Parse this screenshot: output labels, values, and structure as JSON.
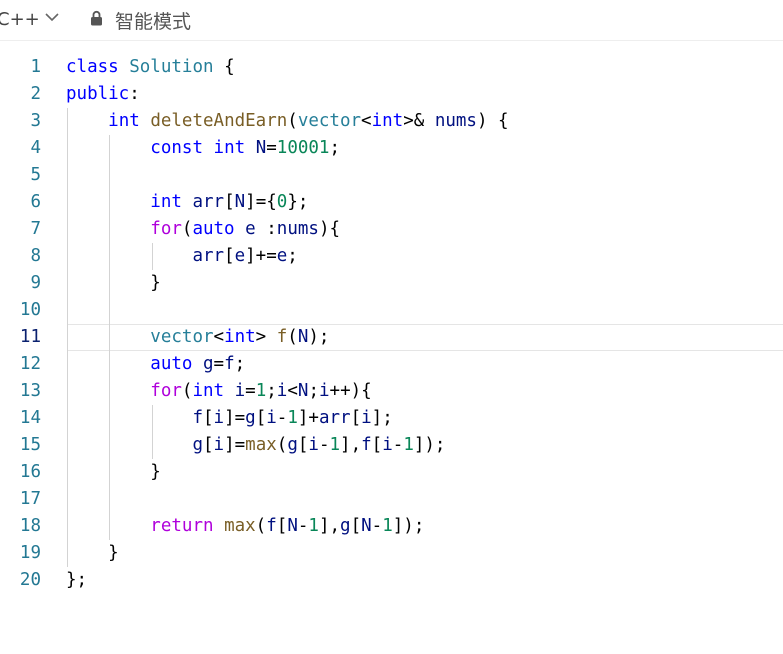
{
  "toolbar": {
    "language": "C++",
    "mode": "智能模式",
    "icons": {
      "language_dropdown": "chevron-down-icon",
      "mode": "lock-icon"
    }
  },
  "editor": {
    "active_line": 11,
    "lines": [
      {
        "n": "1",
        "tokens": [
          [
            "keyword",
            "class"
          ],
          [
            "plain",
            " "
          ],
          [
            "type",
            "Solution"
          ],
          [
            "plain",
            " {"
          ]
        ]
      },
      {
        "n": "2",
        "tokens": [
          [
            "keyword",
            "public"
          ],
          [
            "plain",
            ":"
          ]
        ]
      },
      {
        "n": "3",
        "tokens": [
          [
            "plain",
            "    "
          ],
          [
            "keyword",
            "int"
          ],
          [
            "plain",
            " "
          ],
          [
            "func",
            "deleteAndEarn"
          ],
          [
            "plain",
            "("
          ],
          [
            "type",
            "vector"
          ],
          [
            "plain",
            "<"
          ],
          [
            "keyword",
            "int"
          ],
          [
            "plain",
            ">& "
          ],
          [
            "var",
            "nums"
          ],
          [
            "plain",
            ") {"
          ]
        ]
      },
      {
        "n": "4",
        "tokens": [
          [
            "plain",
            "        "
          ],
          [
            "keyword",
            "const"
          ],
          [
            "plain",
            " "
          ],
          [
            "keyword",
            "int"
          ],
          [
            "plain",
            " "
          ],
          [
            "var",
            "N"
          ],
          [
            "plain",
            "="
          ],
          [
            "number",
            "10001"
          ],
          [
            "plain",
            ";"
          ]
        ]
      },
      {
        "n": "5",
        "tokens": []
      },
      {
        "n": "6",
        "tokens": [
          [
            "plain",
            "        "
          ],
          [
            "keyword",
            "int"
          ],
          [
            "plain",
            " "
          ],
          [
            "var",
            "arr"
          ],
          [
            "plain",
            "["
          ],
          [
            "var",
            "N"
          ],
          [
            "plain",
            "]={"
          ],
          [
            "number",
            "0"
          ],
          [
            "plain",
            "};"
          ]
        ]
      },
      {
        "n": "7",
        "tokens": [
          [
            "plain",
            "        "
          ],
          [
            "control",
            "for"
          ],
          [
            "plain",
            "("
          ],
          [
            "keyword",
            "auto"
          ],
          [
            "plain",
            " "
          ],
          [
            "var",
            "e"
          ],
          [
            "plain",
            " :"
          ],
          [
            "var",
            "nums"
          ],
          [
            "plain",
            "){"
          ]
        ]
      },
      {
        "n": "8",
        "tokens": [
          [
            "plain",
            "            "
          ],
          [
            "var",
            "arr"
          ],
          [
            "plain",
            "["
          ],
          [
            "var",
            "e"
          ],
          [
            "plain",
            "]+="
          ],
          [
            "var",
            "e"
          ],
          [
            "plain",
            ";"
          ]
        ]
      },
      {
        "n": "9",
        "tokens": [
          [
            "plain",
            "        }"
          ]
        ]
      },
      {
        "n": "10",
        "tokens": []
      },
      {
        "n": "11",
        "tokens": [
          [
            "plain",
            "        "
          ],
          [
            "type",
            "vector"
          ],
          [
            "plain",
            "<"
          ],
          [
            "keyword",
            "int"
          ],
          [
            "plain",
            "> "
          ],
          [
            "func",
            "f"
          ],
          [
            "plain",
            "("
          ],
          [
            "var",
            "N"
          ],
          [
            "plain",
            ");"
          ]
        ]
      },
      {
        "n": "12",
        "tokens": [
          [
            "plain",
            "        "
          ],
          [
            "keyword",
            "auto"
          ],
          [
            "plain",
            " "
          ],
          [
            "var",
            "g"
          ],
          [
            "plain",
            "="
          ],
          [
            "var",
            "f"
          ],
          [
            "plain",
            ";"
          ]
        ]
      },
      {
        "n": "13",
        "tokens": [
          [
            "plain",
            "        "
          ],
          [
            "control",
            "for"
          ],
          [
            "plain",
            "("
          ],
          [
            "keyword",
            "int"
          ],
          [
            "plain",
            " "
          ],
          [
            "var",
            "i"
          ],
          [
            "plain",
            "="
          ],
          [
            "number",
            "1"
          ],
          [
            "plain",
            ";"
          ],
          [
            "var",
            "i"
          ],
          [
            "plain",
            "<"
          ],
          [
            "var",
            "N"
          ],
          [
            "plain",
            ";"
          ],
          [
            "var",
            "i"
          ],
          [
            "plain",
            "++){"
          ]
        ]
      },
      {
        "n": "14",
        "tokens": [
          [
            "plain",
            "            "
          ],
          [
            "var",
            "f"
          ],
          [
            "plain",
            "["
          ],
          [
            "var",
            "i"
          ],
          [
            "plain",
            "]="
          ],
          [
            "var",
            "g"
          ],
          [
            "plain",
            "["
          ],
          [
            "var",
            "i"
          ],
          [
            "plain",
            "-"
          ],
          [
            "number",
            "1"
          ],
          [
            "plain",
            "]+"
          ],
          [
            "var",
            "arr"
          ],
          [
            "plain",
            "["
          ],
          [
            "var",
            "i"
          ],
          [
            "plain",
            "];"
          ]
        ]
      },
      {
        "n": "15",
        "tokens": [
          [
            "plain",
            "            "
          ],
          [
            "var",
            "g"
          ],
          [
            "plain",
            "["
          ],
          [
            "var",
            "i"
          ],
          [
            "plain",
            "]="
          ],
          [
            "func",
            "max"
          ],
          [
            "plain",
            "("
          ],
          [
            "var",
            "g"
          ],
          [
            "plain",
            "["
          ],
          [
            "var",
            "i"
          ],
          [
            "plain",
            "-"
          ],
          [
            "number",
            "1"
          ],
          [
            "plain",
            "],"
          ],
          [
            "var",
            "f"
          ],
          [
            "plain",
            "["
          ],
          [
            "var",
            "i"
          ],
          [
            "plain",
            "-"
          ],
          [
            "number",
            "1"
          ],
          [
            "plain",
            "]);"
          ]
        ]
      },
      {
        "n": "16",
        "tokens": [
          [
            "plain",
            "        }"
          ]
        ]
      },
      {
        "n": "17",
        "tokens": []
      },
      {
        "n": "18",
        "tokens": [
          [
            "plain",
            "        "
          ],
          [
            "control",
            "return"
          ],
          [
            "plain",
            " "
          ],
          [
            "func",
            "max"
          ],
          [
            "plain",
            "("
          ],
          [
            "var",
            "f"
          ],
          [
            "plain",
            "["
          ],
          [
            "var",
            "N"
          ],
          [
            "plain",
            "-"
          ],
          [
            "number",
            "1"
          ],
          [
            "plain",
            "],"
          ],
          [
            "var",
            "g"
          ],
          [
            "plain",
            "["
          ],
          [
            "var",
            "N"
          ],
          [
            "plain",
            "-"
          ],
          [
            "number",
            "1"
          ],
          [
            "plain",
            "]);"
          ]
        ]
      },
      {
        "n": "19",
        "tokens": [
          [
            "plain",
            "    }"
          ]
        ]
      },
      {
        "n": "20",
        "tokens": [
          [
            "plain",
            "};"
          ]
        ]
      }
    ]
  }
}
